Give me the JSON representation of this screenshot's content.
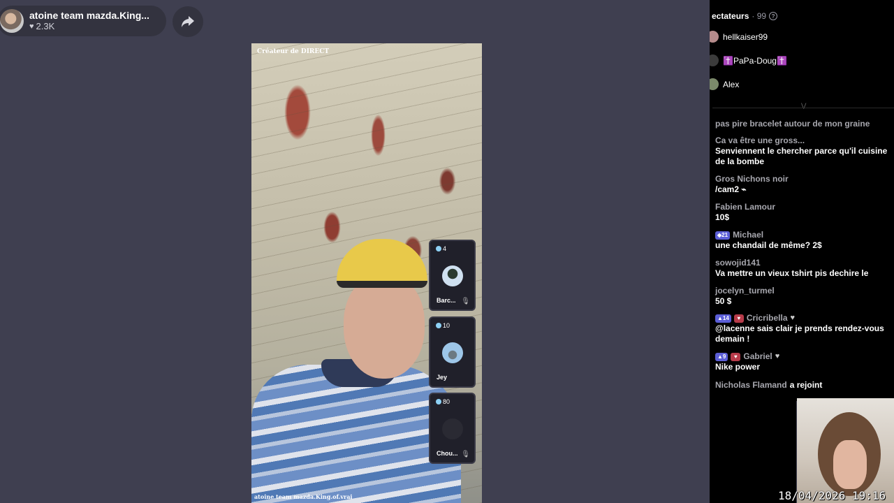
{
  "host": {
    "name": "atoine team mazda.King...",
    "likes": "2.3K"
  },
  "video": {
    "creator_tag": "Créateur de DIRECT",
    "caption": "atoine team mazda.King.of.vrai"
  },
  "guests": [
    {
      "count": "4",
      "name": "Barc..."
    },
    {
      "count": "10",
      "name": "Jey"
    },
    {
      "count": "80",
      "name": "Chou..."
    }
  ],
  "viewers": {
    "title": "ectateurs",
    "count": "· 99",
    "list": [
      {
        "name": "hellkaiser99"
      },
      {
        "name": "✝️PaPa-Doug✝️"
      },
      {
        "name": "Alex"
      }
    ]
  },
  "chat": [
    {
      "user": "pas pire bracelet autour de mon graine",
      "text": ""
    },
    {
      "user": "Ca va être une gross...",
      "text": "Senviennent le chercher parce qu'il cuisine de la bombe"
    },
    {
      "user": "Gros Nichons noir",
      "text": "/cam2 ⌁"
    },
    {
      "user": "Fabien Lamour",
      "text": "10$"
    },
    {
      "badge": "21",
      "user": "Michael",
      "text": "une chandail de même? 2$"
    },
    {
      "user": "sowojid141",
      "text": "Va mettre un vieux tshirt pis dechire le"
    },
    {
      "user": "jocelyn_turmel",
      "text": "50 $"
    },
    {
      "badge": "14",
      "user": "Cricribella",
      "text": "@lacenne sais clair je prends rendez-vous demain !"
    },
    {
      "badge": "9",
      "user": "Gabriel",
      "text": "Nike power"
    },
    {
      "user": "Nicholas Flamand",
      "joined": "a rejoint"
    }
  ],
  "timestamp": "18/04/2026 19:16",
  "colors": {
    "background": "#3f3f50",
    "panel": "#000000",
    "badge": "#5b5ed6"
  }
}
